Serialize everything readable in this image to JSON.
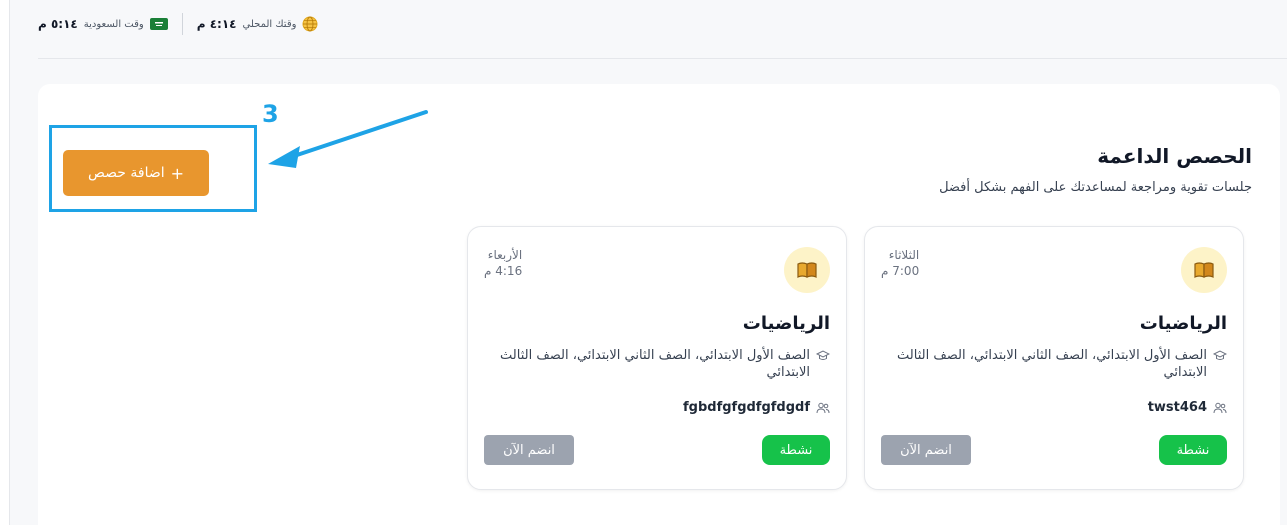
{
  "topbar": {
    "saudi_label": "وقت السعودية",
    "saudi_time": "٥:١٤ م",
    "local_label": "وقتك المحلي",
    "local_time": "٤:١٤ م",
    "globe_icon": "globe-icon",
    "flag_icon": "saudi-flag-icon"
  },
  "section": {
    "title": "الحصص الداعمة",
    "subtitle": "جلسات تقوية ومراجعة لمساعدتك على الفهم بشكل أفضل"
  },
  "add_button": {
    "label": "اضافة حصص",
    "icon": "plus-icon"
  },
  "annotation": {
    "step": "3",
    "color": "#1ea3e6"
  },
  "cards": [
    {
      "day": "الثلاثاء",
      "time": "7:00 م",
      "subject": "الرياضيات",
      "grades": "الصف الأول الابتدائي، الصف الثاني الابتدائي، الصف الثالث الابتدائي",
      "code": "twst464",
      "status": "نشطة",
      "join_label": "انضم الآن",
      "icon": "book-icon"
    },
    {
      "day": "الأربعاء",
      "time": "4:16 م",
      "subject": "الرياضيات",
      "grades": "الصف الأول الابتدائي، الصف الثاني الابتدائي، الصف الثالث الابتدائي",
      "code": "fgbdfgfgdfgfdgdf",
      "status": "نشطة",
      "join_label": "انضم الآن",
      "icon": "book-icon"
    }
  ],
  "colors": {
    "accent_orange": "#e8962e",
    "status_green": "#16c24a",
    "join_gray": "#9ca3af",
    "icon_bg": "#fdf3c8"
  }
}
